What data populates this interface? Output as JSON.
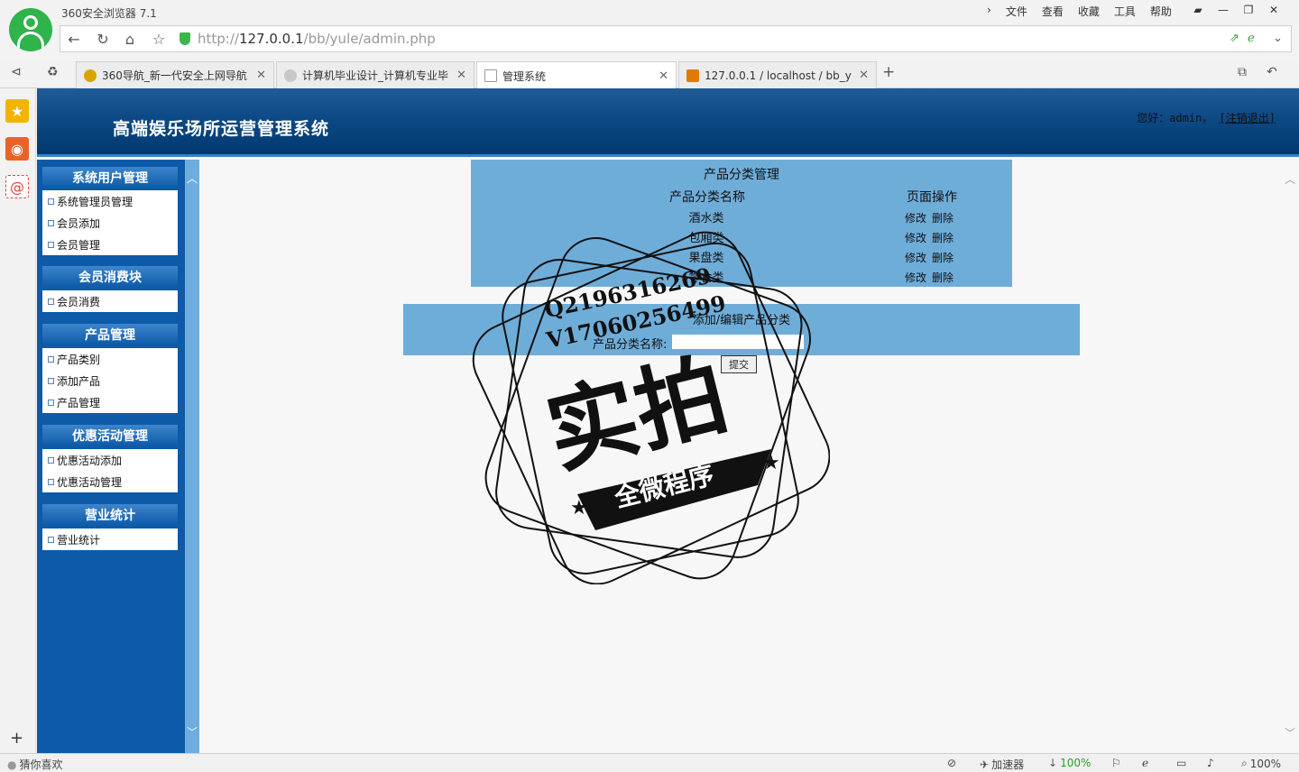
{
  "browser": {
    "app_title": "360安全浏览器 7.1",
    "menu": [
      "文件",
      "查看",
      "收藏",
      "工具",
      "帮助"
    ],
    "url_prefix": "http://",
    "url_host": "127.0.0.1",
    "url_path": "/bb/yule/admin.php",
    "tabs": [
      {
        "label": "360导航_新一代安全上网导航",
        "icon_color": "#d8a500"
      },
      {
        "label": "计算机毕业设计_计算机专业毕",
        "icon_color": "#888888"
      },
      {
        "label": "管理系统",
        "icon_color": "#ffffff"
      },
      {
        "label": "127.0.0.1 / localhost / bb_y",
        "icon_color": "#e07a00"
      }
    ],
    "new_tab_symbol": "+",
    "status": {
      "left": "猜你喜欢",
      "accelerator": "加速器",
      "download": "100%",
      "zoom": "100%"
    }
  },
  "site": {
    "title": "高端娱乐场所运营管理系统",
    "greeting": "您好：admin，",
    "logout": "[注销退出]"
  },
  "sidebar": {
    "sections": [
      {
        "title": "系统用户管理",
        "items": [
          "系统管理员管理",
          "会员添加",
          "会员管理"
        ]
      },
      {
        "title": "会员消费块",
        "items": [
          "会员消费"
        ]
      },
      {
        "title": "产品管理",
        "items": [
          "产品类别",
          "添加产品",
          "产品管理"
        ]
      },
      {
        "title": "优惠活动管理",
        "items": [
          "优惠活动添加",
          "优惠活动管理"
        ]
      },
      {
        "title": "营业统计",
        "items": [
          "营业统计"
        ]
      }
    ]
  },
  "category_panel": {
    "title": "产品分类管理",
    "col_name": "产品分类名称",
    "col_ops": "页面操作",
    "rows": [
      {
        "name": "酒水类",
        "edit": "修改",
        "delete": "删除"
      },
      {
        "name": "包厢类",
        "edit": "修改",
        "delete": "删除"
      },
      {
        "name": "果盘类",
        "edit": "修改",
        "delete": "删除"
      },
      {
        "name": "零食类",
        "edit": "修改",
        "delete": "删除"
      }
    ]
  },
  "edit_panel": {
    "title": "添加/编辑产品分类",
    "field_label": "产品分类名称:",
    "field_value": "",
    "submit": "提交"
  },
  "watermark": {
    "line1": "Q2196316269",
    "line2": "V17060256499",
    "big": "实拍",
    "banner": "全微程序"
  }
}
